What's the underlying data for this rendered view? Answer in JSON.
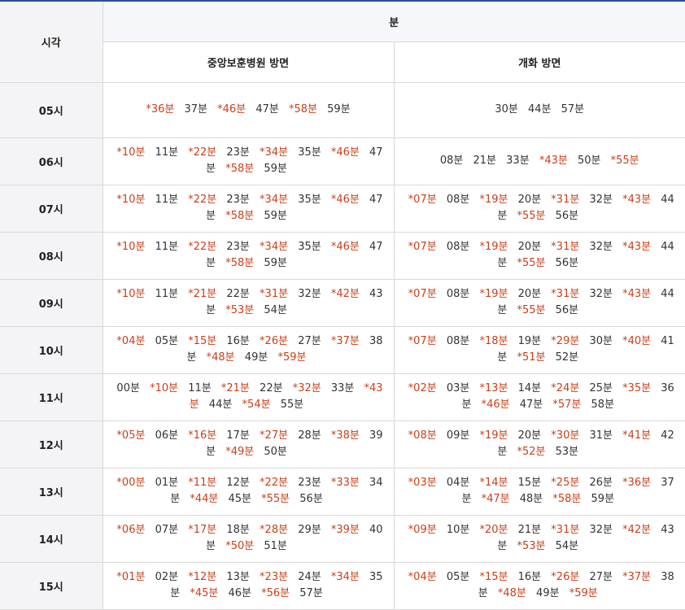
{
  "header": {
    "hour_label": "시각",
    "minute_label": "분",
    "routes": [
      "중앙보훈병원 방면",
      "개화 방면"
    ]
  },
  "colors": {
    "accent_border": "#2a4f99",
    "marked_time": "#c8401a",
    "normal_time": "#333333"
  },
  "rows": [
    {
      "hour": "05시",
      "left": [
        {
          "t": "36분",
          "m": true
        },
        {
          "t": "37분",
          "m": false
        },
        {
          "t": "46분",
          "m": true
        },
        {
          "t": "47분",
          "m": false
        },
        {
          "t": "58분",
          "m": true
        },
        {
          "t": "59분",
          "m": false
        }
      ],
      "right": [
        {
          "t": "30분",
          "m": false
        },
        {
          "t": "44분",
          "m": false
        },
        {
          "t": "57분",
          "m": false
        }
      ]
    },
    {
      "hour": "06시",
      "left": [
        {
          "t": "10분",
          "m": true
        },
        {
          "t": "11분",
          "m": false
        },
        {
          "t": "22분",
          "m": true
        },
        {
          "t": "23분",
          "m": false
        },
        {
          "t": "34분",
          "m": true
        },
        {
          "t": "35분",
          "m": false
        },
        {
          "t": "46분",
          "m": true
        },
        {
          "t": "47분",
          "m": false
        },
        {
          "t": "58분",
          "m": true
        },
        {
          "t": "59분",
          "m": false
        }
      ],
      "right": [
        {
          "t": "08분",
          "m": false
        },
        {
          "t": "21분",
          "m": false
        },
        {
          "t": "33분",
          "m": false
        },
        {
          "t": "43분",
          "m": true
        },
        {
          "t": "50분",
          "m": false
        },
        {
          "t": "55분",
          "m": true
        }
      ]
    },
    {
      "hour": "07시",
      "left": [
        {
          "t": "10분",
          "m": true
        },
        {
          "t": "11분",
          "m": false
        },
        {
          "t": "22분",
          "m": true
        },
        {
          "t": "23분",
          "m": false
        },
        {
          "t": "34분",
          "m": true
        },
        {
          "t": "35분",
          "m": false
        },
        {
          "t": "46분",
          "m": true
        },
        {
          "t": "47분",
          "m": false
        },
        {
          "t": "58분",
          "m": true
        },
        {
          "t": "59분",
          "m": false
        }
      ],
      "right": [
        {
          "t": "07분",
          "m": true
        },
        {
          "t": "08분",
          "m": false
        },
        {
          "t": "19분",
          "m": true
        },
        {
          "t": "20분",
          "m": false
        },
        {
          "t": "31분",
          "m": true
        },
        {
          "t": "32분",
          "m": false
        },
        {
          "t": "43분",
          "m": true
        },
        {
          "t": "44분",
          "m": false
        },
        {
          "t": "55분",
          "m": true
        },
        {
          "t": "56분",
          "m": false
        }
      ]
    },
    {
      "hour": "08시",
      "left": [
        {
          "t": "10분",
          "m": true
        },
        {
          "t": "11분",
          "m": false
        },
        {
          "t": "22분",
          "m": true
        },
        {
          "t": "23분",
          "m": false
        },
        {
          "t": "34분",
          "m": true
        },
        {
          "t": "35분",
          "m": false
        },
        {
          "t": "46분",
          "m": true
        },
        {
          "t": "47분",
          "m": false
        },
        {
          "t": "58분",
          "m": true
        },
        {
          "t": "59분",
          "m": false
        }
      ],
      "right": [
        {
          "t": "07분",
          "m": true
        },
        {
          "t": "08분",
          "m": false
        },
        {
          "t": "19분",
          "m": true
        },
        {
          "t": "20분",
          "m": false
        },
        {
          "t": "31분",
          "m": true
        },
        {
          "t": "32분",
          "m": false
        },
        {
          "t": "43분",
          "m": true
        },
        {
          "t": "44분",
          "m": false
        },
        {
          "t": "55분",
          "m": true
        },
        {
          "t": "56분",
          "m": false
        }
      ]
    },
    {
      "hour": "09시",
      "left": [
        {
          "t": "10분",
          "m": true
        },
        {
          "t": "11분",
          "m": false
        },
        {
          "t": "21분",
          "m": true
        },
        {
          "t": "22분",
          "m": false
        },
        {
          "t": "31분",
          "m": true
        },
        {
          "t": "32분",
          "m": false
        },
        {
          "t": "42분",
          "m": true
        },
        {
          "t": "43분",
          "m": false
        },
        {
          "t": "53분",
          "m": true
        },
        {
          "t": "54분",
          "m": false
        }
      ],
      "right": [
        {
          "t": "07분",
          "m": true
        },
        {
          "t": "08분",
          "m": false
        },
        {
          "t": "19분",
          "m": true
        },
        {
          "t": "20분",
          "m": false
        },
        {
          "t": "31분",
          "m": true
        },
        {
          "t": "32분",
          "m": false
        },
        {
          "t": "43분",
          "m": true
        },
        {
          "t": "44분",
          "m": false
        },
        {
          "t": "55분",
          "m": true
        },
        {
          "t": "56분",
          "m": false
        }
      ]
    },
    {
      "hour": "10시",
      "left": [
        {
          "t": "04분",
          "m": true
        },
        {
          "t": "05분",
          "m": false
        },
        {
          "t": "15분",
          "m": true
        },
        {
          "t": "16분",
          "m": false
        },
        {
          "t": "26분",
          "m": true
        },
        {
          "t": "27분",
          "m": false
        },
        {
          "t": "37분",
          "m": true
        },
        {
          "t": "38분",
          "m": false
        },
        {
          "t": "48분",
          "m": true
        },
        {
          "t": "49분",
          "m": false
        },
        {
          "t": "59분",
          "m": true
        }
      ],
      "right": [
        {
          "t": "07분",
          "m": true
        },
        {
          "t": "08분",
          "m": false
        },
        {
          "t": "18분",
          "m": true
        },
        {
          "t": "19분",
          "m": false
        },
        {
          "t": "29분",
          "m": true
        },
        {
          "t": "30분",
          "m": false
        },
        {
          "t": "40분",
          "m": true
        },
        {
          "t": "41분",
          "m": false
        },
        {
          "t": "51분",
          "m": true
        },
        {
          "t": "52분",
          "m": false
        }
      ]
    },
    {
      "hour": "11시",
      "left": [
        {
          "t": "00분",
          "m": false
        },
        {
          "t": "10분",
          "m": true
        },
        {
          "t": "11분",
          "m": false
        },
        {
          "t": "21분",
          "m": true
        },
        {
          "t": "22분",
          "m": false
        },
        {
          "t": "32분",
          "m": true
        },
        {
          "t": "33분",
          "m": false
        },
        {
          "t": "43분",
          "m": true
        },
        {
          "t": "44분",
          "m": false
        },
        {
          "t": "54분",
          "m": true
        },
        {
          "t": "55분",
          "m": false
        }
      ],
      "right": [
        {
          "t": "02분",
          "m": true
        },
        {
          "t": "03분",
          "m": false
        },
        {
          "t": "13분",
          "m": true
        },
        {
          "t": "14분",
          "m": false
        },
        {
          "t": "24분",
          "m": true
        },
        {
          "t": "25분",
          "m": false
        },
        {
          "t": "35분",
          "m": true
        },
        {
          "t": "36분",
          "m": false
        },
        {
          "t": "46분",
          "m": true
        },
        {
          "t": "47분",
          "m": false
        },
        {
          "t": "57분",
          "m": true
        },
        {
          "t": "58분",
          "m": false
        }
      ]
    },
    {
      "hour": "12시",
      "left": [
        {
          "t": "05분",
          "m": true
        },
        {
          "t": "06분",
          "m": false
        },
        {
          "t": "16분",
          "m": true
        },
        {
          "t": "17분",
          "m": false
        },
        {
          "t": "27분",
          "m": true
        },
        {
          "t": "28분",
          "m": false
        },
        {
          "t": "38분",
          "m": true
        },
        {
          "t": "39분",
          "m": false
        },
        {
          "t": "49분",
          "m": true
        },
        {
          "t": "50분",
          "m": false
        }
      ],
      "right": [
        {
          "t": "08분",
          "m": true
        },
        {
          "t": "09분",
          "m": false
        },
        {
          "t": "19분",
          "m": true
        },
        {
          "t": "20분",
          "m": false
        },
        {
          "t": "30분",
          "m": true
        },
        {
          "t": "31분",
          "m": false
        },
        {
          "t": "41분",
          "m": true
        },
        {
          "t": "42분",
          "m": false
        },
        {
          "t": "52분",
          "m": true
        },
        {
          "t": "53분",
          "m": false
        }
      ]
    },
    {
      "hour": "13시",
      "left": [
        {
          "t": "00분",
          "m": true
        },
        {
          "t": "01분",
          "m": false
        },
        {
          "t": "11분",
          "m": true
        },
        {
          "t": "12분",
          "m": false
        },
        {
          "t": "22분",
          "m": true
        },
        {
          "t": "23분",
          "m": false
        },
        {
          "t": "33분",
          "m": true
        },
        {
          "t": "34분",
          "m": false
        },
        {
          "t": "44분",
          "m": true
        },
        {
          "t": "45분",
          "m": false
        },
        {
          "t": "55분",
          "m": true
        },
        {
          "t": "56분",
          "m": false
        }
      ],
      "right": [
        {
          "t": "03분",
          "m": true
        },
        {
          "t": "04분",
          "m": false
        },
        {
          "t": "14분",
          "m": true
        },
        {
          "t": "15분",
          "m": false
        },
        {
          "t": "25분",
          "m": true
        },
        {
          "t": "26분",
          "m": false
        },
        {
          "t": "36분",
          "m": true
        },
        {
          "t": "37분",
          "m": false
        },
        {
          "t": "47분",
          "m": true
        },
        {
          "t": "48분",
          "m": false
        },
        {
          "t": "58분",
          "m": true
        },
        {
          "t": "59분",
          "m": false
        }
      ]
    },
    {
      "hour": "14시",
      "left": [
        {
          "t": "06분",
          "m": true
        },
        {
          "t": "07분",
          "m": false
        },
        {
          "t": "17분",
          "m": true
        },
        {
          "t": "18분",
          "m": false
        },
        {
          "t": "28분",
          "m": true
        },
        {
          "t": "29분",
          "m": false
        },
        {
          "t": "39분",
          "m": true
        },
        {
          "t": "40분",
          "m": false
        },
        {
          "t": "50분",
          "m": true
        },
        {
          "t": "51분",
          "m": false
        }
      ],
      "right": [
        {
          "t": "09분",
          "m": true
        },
        {
          "t": "10분",
          "m": false
        },
        {
          "t": "20분",
          "m": true
        },
        {
          "t": "21분",
          "m": false
        },
        {
          "t": "31분",
          "m": true
        },
        {
          "t": "32분",
          "m": false
        },
        {
          "t": "42분",
          "m": true
        },
        {
          "t": "43분",
          "m": false
        },
        {
          "t": "53분",
          "m": true
        },
        {
          "t": "54분",
          "m": false
        }
      ]
    },
    {
      "hour": "15시",
      "left": [
        {
          "t": "01분",
          "m": true
        },
        {
          "t": "02분",
          "m": false
        },
        {
          "t": "12분",
          "m": true
        },
        {
          "t": "13분",
          "m": false
        },
        {
          "t": "23분",
          "m": true
        },
        {
          "t": "24분",
          "m": false
        },
        {
          "t": "34분",
          "m": true
        },
        {
          "t": "35분",
          "m": false
        },
        {
          "t": "45분",
          "m": true
        },
        {
          "t": "46분",
          "m": false
        },
        {
          "t": "56분",
          "m": true
        },
        {
          "t": "57분",
          "m": false
        }
      ],
      "right": [
        {
          "t": "04분",
          "m": true
        },
        {
          "t": "05분",
          "m": false
        },
        {
          "t": "15분",
          "m": true
        },
        {
          "t": "16분",
          "m": false
        },
        {
          "t": "26분",
          "m": true
        },
        {
          "t": "27분",
          "m": false
        },
        {
          "t": "37분",
          "m": true
        },
        {
          "t": "38분",
          "m": false
        },
        {
          "t": "48분",
          "m": true
        },
        {
          "t": "49분",
          "m": false
        },
        {
          "t": "59분",
          "m": true
        }
      ]
    }
  ]
}
